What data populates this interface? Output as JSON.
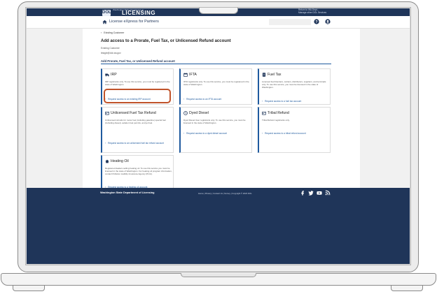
{
  "top_bar": {
    "brand_small": "Washington State Department of",
    "brand_big": "LICENSING",
    "brand_mark": "DOL",
    "right_line1": "Return to WA.Dept...",
    "right_line2": "Manage other DOL Services"
  },
  "app_header": {
    "title": "License eXpress for Partners",
    "home_icon": "home-icon",
    "help_icon": "question-circle-icon",
    "user_icon": "user-circle-icon"
  },
  "breadcrumb": {
    "back_label": "Existing Customer"
  },
  "page": {
    "title": "Add access to a Prorate, Fuel Tax, or Unlicensed Refund account",
    "customer_label": "Existing Customer",
    "customer_email": "lelagie@dol.wa.gov",
    "section_title": "Add Prorate, Fuel Tax, or Unlicensed Refund account"
  },
  "cards": [
    {
      "title": "IRP",
      "icon": "truck-icon",
      "desc": "IRP registrants only. To use this service, you must be registered in the state of Washington.",
      "link": "Request access to an existing IRP account"
    },
    {
      "title": "IFTA",
      "icon": "calendar-icon",
      "desc": "IFTA registrants only. To use this service, you must be registered in the state of Washington.",
      "link": "Request access to an IFTA account"
    },
    {
      "title": "Fuel Tax",
      "icon": "document-icon",
      "desc": "Licensed fuel blenders, carriers, distributors, suppliers, and terminals only. To use this service, you must be licensed in the state of Washington.",
      "link": "Request access to a fuel tax account"
    },
    {
      "title": "Unlicensed Fuel Tax Refund",
      "icon": "id-card-icon",
      "desc": "Unlicensed refunds for motor fuel (including gasoline) special fuel (including diesel), aviation fuel permits, and jet fuel.",
      "link": "Request access to an unlicensed fuel tax refund account"
    },
    {
      "title": "Dyed Diesel",
      "icon": "clock-icon",
      "desc": "Dyed Diesel User registrants only. To use this service, you must be licensed in the state of Washington.",
      "link": "Request access to a dyed diesel account"
    },
    {
      "title": "Tribal Refund",
      "icon": "id-card-icon",
      "desc": "Tribal Refund registrants only.",
      "link": "Request access to a tribal refund account"
    },
    {
      "title": "Heating Oil",
      "icon": "house-icon",
      "desc": "Registered dealers selling heating oil. To use this service you must be licensed in the state of Washington. For heating oil program information, contact Pollution Liability Insurance Agency (PLIA).",
      "link": "Request access to a heating oil account"
    }
  ],
  "footer": {
    "name": "Washington State Department of Licensing",
    "links": "Home | Privacy | Contact Us | Survey | Copyright © 2023 DOL",
    "social": [
      "facebook-icon",
      "twitter-icon",
      "youtube-icon",
      "rss-icon"
    ]
  },
  "colors": {
    "navy": "#1f3559",
    "link_blue": "#1f5a9e",
    "highlight": "#c0532a"
  }
}
